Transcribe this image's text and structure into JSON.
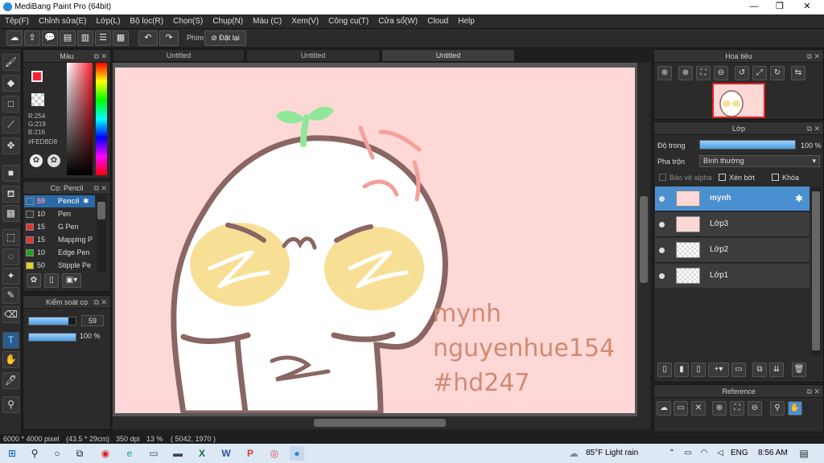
{
  "window": {
    "title": "MediBang Paint Pro (64bit)",
    "minimize": "—",
    "maximize": "❐",
    "close": "✕"
  },
  "menu": [
    "Tệp(F)",
    "Chỉnh sửa(E)",
    "Lớp(L)",
    "Bộ lọc(R)",
    "Chọn(S)",
    "Chụp(N)",
    "Màu (C)",
    "Xem(V)",
    "Công cụ(T)",
    "Cửa sổ(W)",
    "Cloud",
    "Help"
  ],
  "toolbar": {
    "shortcut_label": "Phím",
    "reset_label": "Đặt lại"
  },
  "tabs": [
    "Untitled",
    "Untitled",
    "Untitled"
  ],
  "color_panel": {
    "title": "Màu",
    "r": "R:254",
    "g": "G:219",
    "b": "B:216",
    "hex": "#FEDBD8",
    "primary_color": "#fe2030",
    "secondary_color": "#5a1fc0"
  },
  "brush_panel": {
    "title": "Cọ: Pencil",
    "items": [
      {
        "size": "59",
        "name": "Pencil",
        "color": "#2a6aa8"
      },
      {
        "size": "10",
        "name": "Pen",
        "color": "#333333"
      },
      {
        "size": "15",
        "name": "G Pen",
        "color": "#e53030"
      },
      {
        "size": "15",
        "name": "Mapping P",
        "color": "#e53030"
      },
      {
        "size": "10",
        "name": "Edge Pen",
        "color": "#20a020"
      },
      {
        "size": "50",
        "name": "Stipple Pe",
        "color": "#e8d020"
      }
    ]
  },
  "brush_control": {
    "title": "Kiểm soát cọ",
    "size": "59",
    "opacity": "100 %",
    "size_fraction": 0.85,
    "opacity_fraction": 1.0
  },
  "navigator": {
    "title": "Hoa tiêu"
  },
  "layer_panel": {
    "title": "Lớp",
    "opacity_label": "Độ trong",
    "opacity_value": "100 %",
    "opacity_fraction": 1.0,
    "blend_label": "Pha trộn",
    "blend_value": "Bình thường",
    "protect_alpha": "Bảo vệ alpha",
    "clip": "Xén bớt",
    "lock": "Khóa",
    "layers": [
      "mynh",
      "Lớp3",
      "Lớp2",
      "Lớp1"
    ]
  },
  "reference_panel": {
    "title": "Reference"
  },
  "canvas_text": [
    "mynh",
    "nguyenhue154",
    "#hd247"
  ],
  "status": {
    "size": "6000 * 4000 pixel",
    "cm": "(43.5 * 29cm)",
    "dpi": "350 dpi",
    "zoom": "13 %",
    "coords": "( 5042, 1970 )"
  },
  "taskbar": {
    "weather": "85°F  Light rain",
    "lang": "ENG",
    "time": "8:56 AM"
  }
}
